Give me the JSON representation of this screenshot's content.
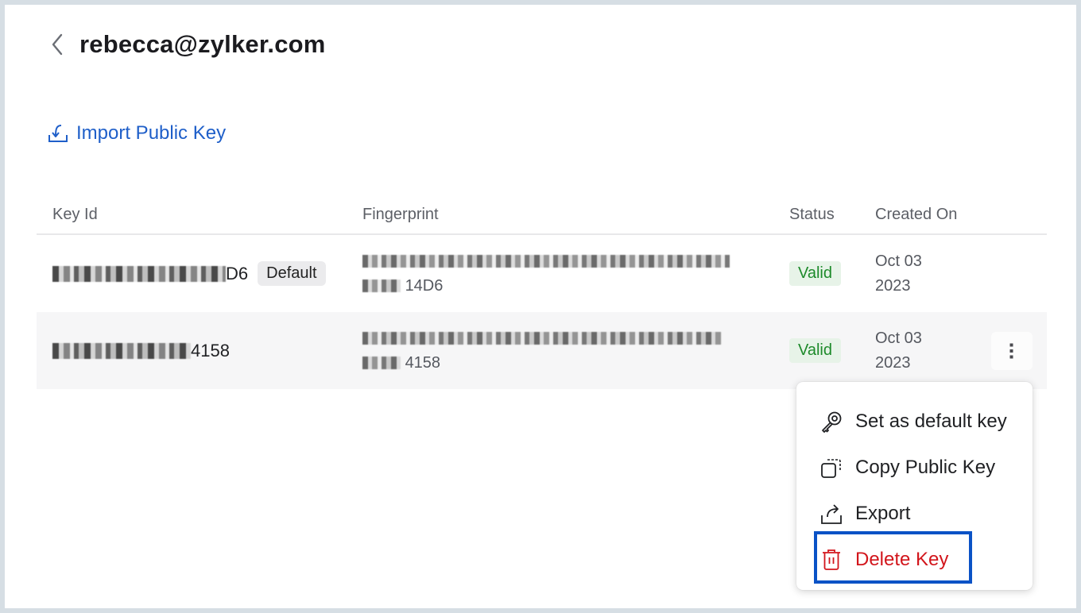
{
  "header": {
    "back_icon": "chevron-left-icon",
    "title": "rebecca@zylker.com"
  },
  "actions": {
    "import_label": "Import Public Key",
    "import_icon": "import-icon"
  },
  "table": {
    "columns": [
      "Key Id",
      "Fingerprint",
      "Status",
      "Created On"
    ],
    "rows": [
      {
        "key_id_suffix": "D6",
        "default_badge": "Default",
        "fingerprint_suffix": "14D6",
        "status": "Valid",
        "created_date": "Oct 03",
        "created_year": "2023"
      },
      {
        "key_id_suffix": "4158",
        "fingerprint_suffix": "4158",
        "status": "Valid",
        "created_date": "Oct 03",
        "created_year": "2023",
        "more_icon": "more-vertical-icon"
      }
    ]
  },
  "menu": {
    "items": [
      {
        "label": "Set as default key",
        "icon": "key-icon"
      },
      {
        "label": "Copy Public Key",
        "icon": "copy-icon"
      },
      {
        "label": "Export",
        "icon": "export-icon"
      },
      {
        "label": "Delete Key",
        "icon": "trash-icon",
        "danger": true,
        "highlighted": true
      }
    ]
  },
  "colors": {
    "accent": "#1f5fc9",
    "danger": "#d2151b",
    "valid": "#1d8a2a",
    "highlight": "#0a52c6"
  }
}
